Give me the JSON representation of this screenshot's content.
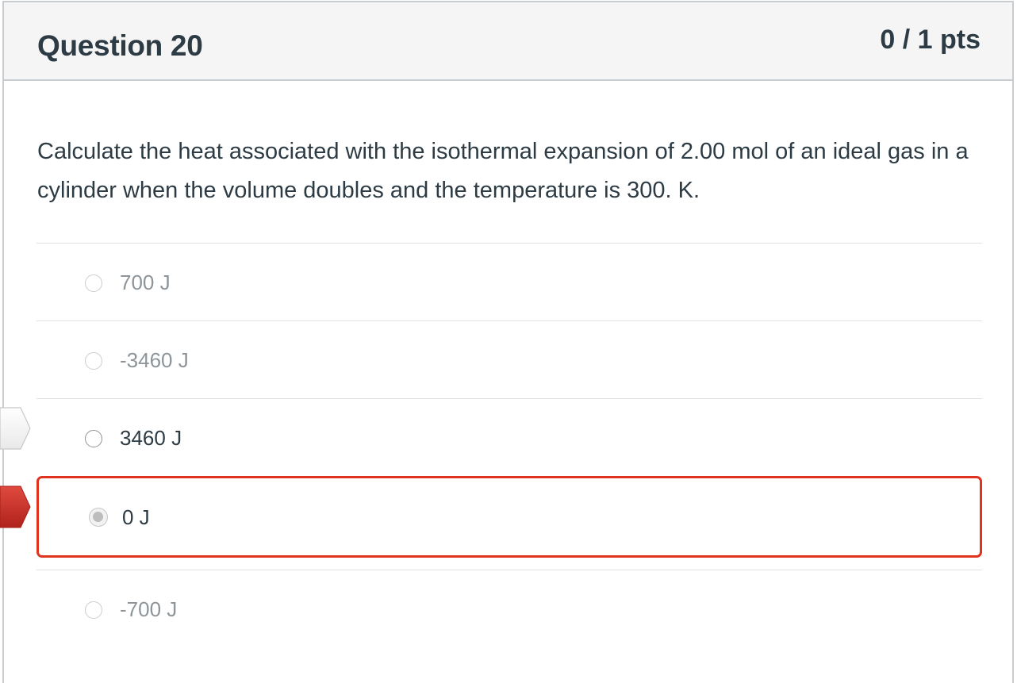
{
  "question": {
    "title": "Question 20",
    "points": "0 / 1 pts",
    "text": "Calculate the heat associated with the isothermal expansion of 2.00 mol of an ideal gas in a cylinder when the volume doubles and the temperature is 300. K."
  },
  "answers": [
    {
      "label": "700 J",
      "selected": false,
      "correct": false
    },
    {
      "label": "-3460 J",
      "selected": false,
      "correct": false
    },
    {
      "label": "3460 J",
      "selected": false,
      "correct": true
    },
    {
      "label": "0 J",
      "selected": true,
      "correct": false
    },
    {
      "label": "-700 J",
      "selected": false,
      "correct": false
    }
  ],
  "icons": {
    "correct_marker": "correct-answer-arrow-icon",
    "selected_marker": "your-answer-arrow-icon"
  },
  "colors": {
    "header_bg": "#f5f5f5",
    "border": "#c7cdd1",
    "text": "#2d3b45",
    "muted_text": "#8d959a",
    "incorrect_red": "#e0331f",
    "marker_red": "#c9302c"
  }
}
